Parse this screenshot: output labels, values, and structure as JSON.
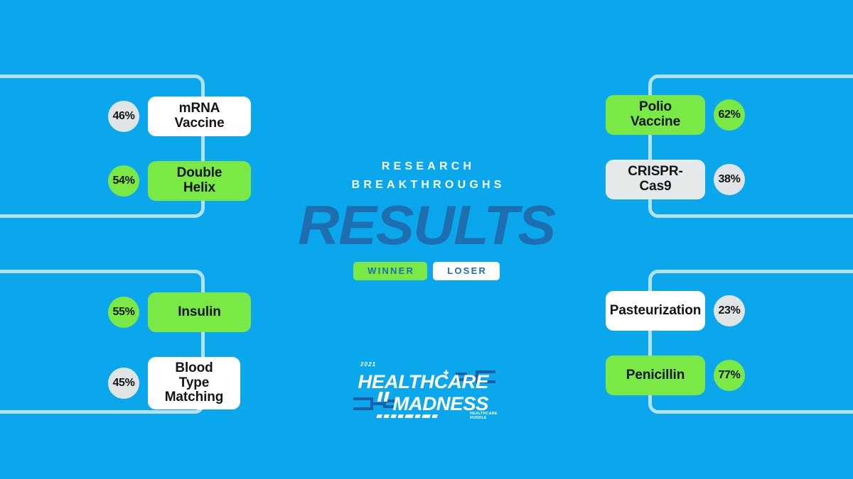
{
  "theme": {
    "background": "#0aa7ec",
    "bracket_line": "#b3e2f7",
    "winner_green": "#7ae845",
    "loser_white": "#ffffff",
    "loser_gray": "#e6e9ea",
    "dark_blue": "#1d6fb0",
    "text_dark": "#111418"
  },
  "center": {
    "kicker_line1": "RESEARCH",
    "kicker_line2": "BREAKTHROUGHS",
    "title": "RESULTS",
    "legend": {
      "winner_label": "WINNER",
      "loser_label": "LOSER"
    }
  },
  "logo": {
    "year": "2021",
    "line1": "HEALTHCARE",
    "line2": "MADNESS",
    "brand_line1": "HEALTHCARE",
    "brand_line2": "HUDDLE"
  },
  "matchups": [
    {
      "id": "left-top",
      "side": "left",
      "competitors": [
        {
          "name": "mRNA Vaccine",
          "percent": "46%",
          "result": "loser",
          "card_style": "loser-white"
        },
        {
          "name": "Double Helix",
          "percent": "54%",
          "result": "winner",
          "card_style": "winner"
        }
      ]
    },
    {
      "id": "left-bottom",
      "side": "left",
      "competitors": [
        {
          "name": "Insulin",
          "percent": "55%",
          "result": "winner",
          "card_style": "winner"
        },
        {
          "name": "Blood Type Matching",
          "percent": "45%",
          "result": "loser",
          "card_style": "loser-white"
        }
      ]
    },
    {
      "id": "right-top",
      "side": "right",
      "competitors": [
        {
          "name": "Polio Vaccine",
          "percent": "62%",
          "result": "winner",
          "card_style": "winner"
        },
        {
          "name": "CRISPR-Cas9",
          "percent": "38%",
          "result": "loser",
          "card_style": "loser-gray"
        }
      ]
    },
    {
      "id": "right-bottom",
      "side": "right",
      "competitors": [
        {
          "name": "Pasteurization",
          "percent": "23%",
          "result": "loser",
          "card_style": "loser-white"
        },
        {
          "name": "Penicillin",
          "percent": "77%",
          "result": "winner",
          "card_style": "winner"
        }
      ]
    }
  ]
}
